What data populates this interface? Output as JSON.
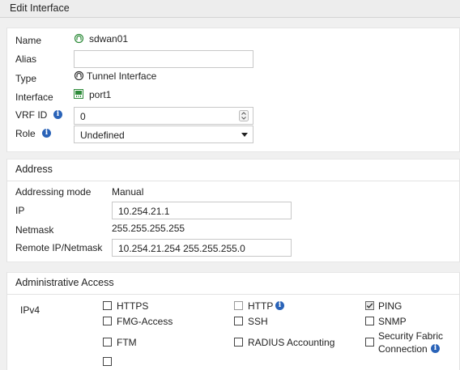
{
  "window": {
    "title": "Edit Interface"
  },
  "general": {
    "name_label": "Name",
    "name_value": "sdwan01",
    "alias_label": "Alias",
    "alias_value": "",
    "type_label": "Type",
    "type_value": "Tunnel Interface",
    "interface_label": "Interface",
    "interface_value": "port1",
    "vrf_label": "VRF ID",
    "vrf_value": "0",
    "role_label": "Role",
    "role_value": "Undefined"
  },
  "address": {
    "section_title": "Address",
    "mode_label": "Addressing mode",
    "mode_value": "Manual",
    "ip_label": "IP",
    "ip_value": "10.254.21.1",
    "netmask_label": "Netmask",
    "netmask_value": "255.255.255.255",
    "remote_label": "Remote IP/Netmask",
    "remote_value": "10.254.21.254 255.255.255.0"
  },
  "admin_access": {
    "section_title": "Administrative Access",
    "ipv4_label": "IPv4",
    "options": [
      {
        "label": "HTTPS",
        "checked": false,
        "disabled": false
      },
      {
        "label": "HTTP",
        "checked": false,
        "disabled": true
      },
      {
        "label": "PING",
        "checked": true,
        "disabled": false
      },
      {
        "label": "FMG-Access",
        "checked": false,
        "disabled": false
      },
      {
        "label": "SSH",
        "checked": false,
        "disabled": false
      },
      {
        "label": "SNMP",
        "checked": false,
        "disabled": false
      },
      {
        "label": "FTM",
        "checked": false,
        "disabled": false
      },
      {
        "label": "RADIUS Accounting",
        "checked": false,
        "disabled": false
      },
      {
        "label_line1": "Security Fabric",
        "label_line2": "Connection",
        "checked": false,
        "disabled": false
      }
    ]
  },
  "icons": {
    "name_icon": "tunnel-interface-icon",
    "type_icon": "tunnel-type-icon",
    "interface_icon": "port-icon",
    "info_icon": "info-icon",
    "spinner_icon": "spinner-icon",
    "dropdown_icon": "chevron-down-icon"
  },
  "colors": {
    "info_blue": "#2a63b8",
    "port_green": "#2e8b3a",
    "name_icon_green": "#2e8b3a"
  }
}
